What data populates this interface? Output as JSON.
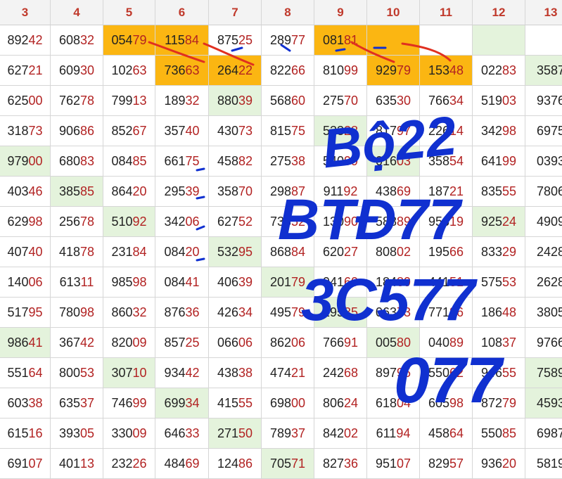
{
  "columns": [
    "3",
    "4",
    "5",
    "6",
    "7",
    "8",
    "9",
    "10",
    "11",
    "12",
    "13"
  ],
  "rows": [
    [
      "89242",
      "60832",
      "05479",
      "11584",
      "87525",
      "28977",
      "08181",
      "",
      "",
      "",
      ""
    ],
    [
      "62721",
      "60930",
      "10263",
      "73663",
      "26422",
      "82266",
      "81099",
      "92979",
      "15348",
      "02283",
      "3587"
    ],
    [
      "62500",
      "76278",
      "79913",
      "18932",
      "88039",
      "56860",
      "27570",
      "63530",
      "76634",
      "51903",
      "9376"
    ],
    [
      "31873",
      "90686",
      "85267",
      "35740",
      "43073",
      "81575",
      "53328",
      "81797",
      "22614",
      "34298",
      "6975"
    ],
    [
      "97900",
      "68083",
      "08485",
      "66175",
      "45882",
      "27538",
      "54099",
      "01603",
      "35854",
      "64199",
      "0393"
    ],
    [
      "40346",
      "38585",
      "86420",
      "29539",
      "35870",
      "29887",
      "91192",
      "43869",
      "18721",
      "83555",
      "7806"
    ],
    [
      "62998",
      "25678",
      "51092",
      "34206",
      "62752",
      "73352",
      "13090",
      "58889",
      "95619",
      "92524",
      "4909"
    ],
    [
      "40740",
      "41878",
      "23184",
      "08420",
      "53295",
      "86884",
      "62027",
      "80802",
      "19566",
      "83329",
      "2428"
    ],
    [
      "14006",
      "61311",
      "98598",
      "08441",
      "40639",
      "20179",
      "94160",
      "18489",
      "44151",
      "57553",
      "2628"
    ],
    [
      "51795",
      "78098",
      "86032",
      "87636",
      "42634",
      "49579",
      "19535",
      "06373",
      "77186",
      "18648",
      "3805"
    ],
    [
      "98641",
      "36742",
      "82009",
      "85725",
      "06606",
      "86206",
      "76691",
      "00580",
      "04089",
      "10837",
      "9766"
    ],
    [
      "55164",
      "80053",
      "30710",
      "93442",
      "43838",
      "47421",
      "24268",
      "89795",
      "55062",
      "94655",
      "7589"
    ],
    [
      "60338",
      "63537",
      "74699",
      "69934",
      "41555",
      "69800",
      "80624",
      "61804",
      "60598",
      "87279",
      "4593"
    ],
    [
      "61516",
      "39305",
      "33009",
      "64633",
      "27150",
      "78937",
      "84202",
      "61194",
      "45864",
      "55085",
      "6987"
    ],
    [
      "69107",
      "40113",
      "23226",
      "48469",
      "12486",
      "70571",
      "82736",
      "95107",
      "82957",
      "93620",
      "5819"
    ]
  ],
  "highlights_gold": [
    [
      0,
      2
    ],
    [
      0,
      3
    ],
    [
      0,
      6
    ],
    [
      0,
      7
    ],
    [
      1,
      3
    ],
    [
      1,
      4
    ],
    [
      1,
      7
    ],
    [
      1,
      8
    ]
  ],
  "highlights_green": [
    [
      0,
      9
    ],
    [
      1,
      10
    ],
    [
      2,
      4
    ],
    [
      3,
      6
    ],
    [
      4,
      0
    ],
    [
      4,
      7
    ],
    [
      5,
      1
    ],
    [
      6,
      2
    ],
    [
      6,
      9
    ],
    [
      7,
      4
    ],
    [
      8,
      5
    ],
    [
      9,
      6
    ],
    [
      10,
      0
    ],
    [
      10,
      7
    ],
    [
      11,
      2
    ],
    [
      11,
      10
    ],
    [
      12,
      3
    ],
    [
      12,
      10
    ],
    [
      13,
      4
    ],
    [
      14,
      5
    ]
  ],
  "annotations": [
    "Bộ22",
    "BTĐ77",
    "3C577",
    "077"
  ],
  "colors": {
    "gold": "#fbb612",
    "green": "#e4f3dc",
    "ink": "#1030d0",
    "red_ink": "#e03020",
    "digit_red": "#b22222"
  }
}
